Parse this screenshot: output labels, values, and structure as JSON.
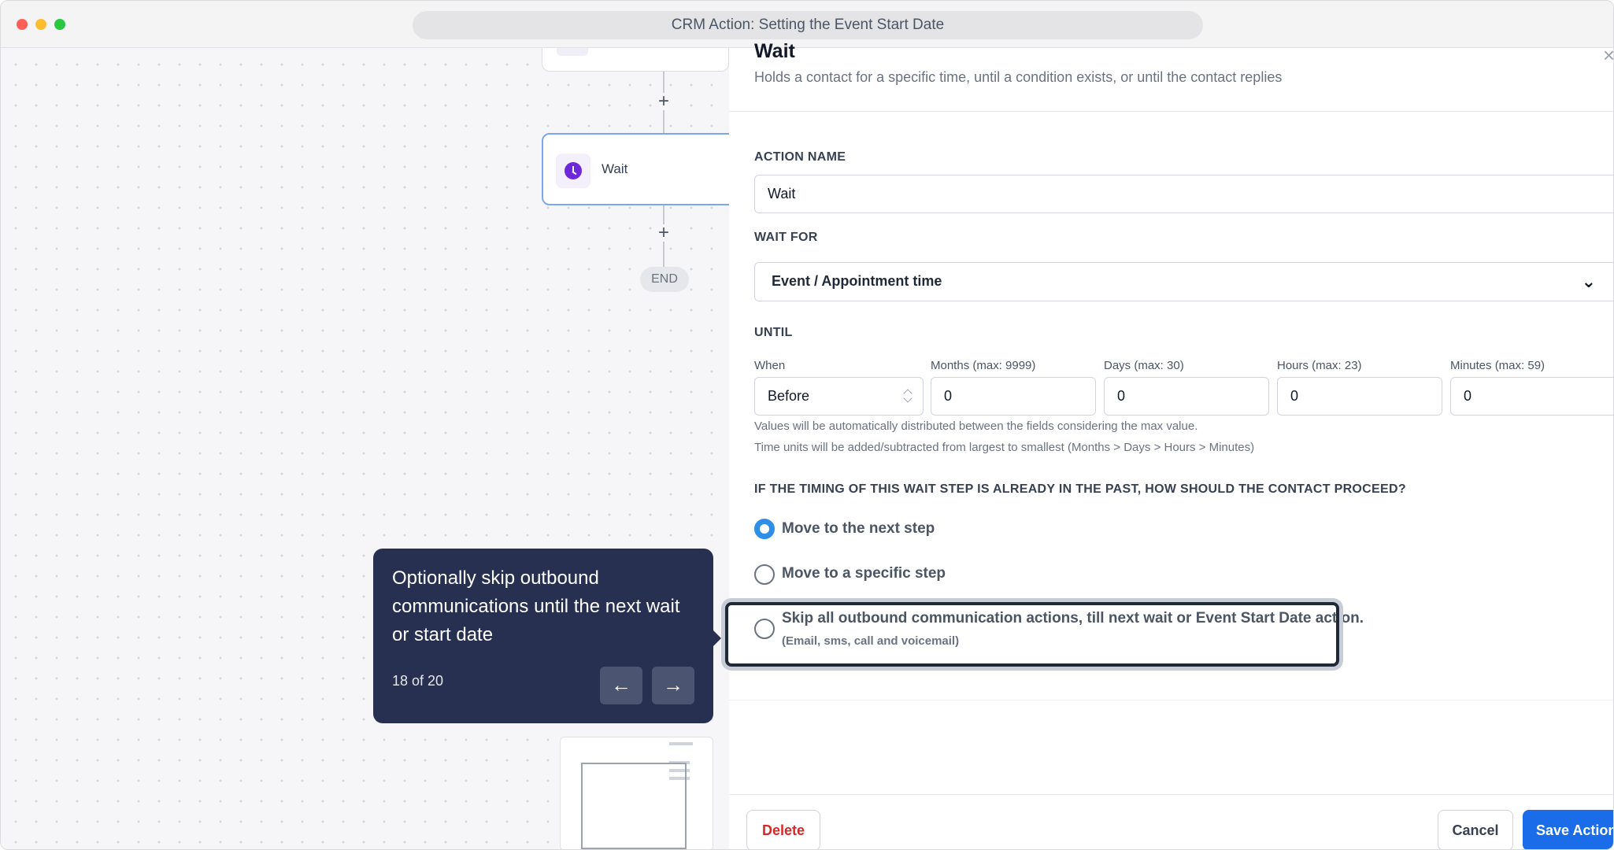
{
  "window": {
    "title": "CRM Action: Setting the Event Start Date"
  },
  "canvas": {
    "wait_node_label": "Wait",
    "plus_symbol": "+",
    "end_label": "END"
  },
  "tooltip": {
    "text": "Optionally skip outbound communications until the next wait or start date",
    "step": "18 of 20",
    "prev_symbol": "←",
    "next_symbol": "→"
  },
  "panel": {
    "title": "Wait",
    "subtitle": "Holds a contact for a specific time, until a condition exists, or until the contact replies",
    "close_symbol": "×",
    "action_name": {
      "label": "ACTION NAME",
      "value": "Wait"
    },
    "wait_for": {
      "label": "WAIT FOR",
      "value": "Event / Appointment time",
      "chevron": "⌄"
    },
    "until": {
      "label": "UNTIL",
      "when_label": "When",
      "when_value": "Before",
      "months_label": "Months (max: 9999)",
      "months_value": "0",
      "days_label": "Days (max: 30)",
      "days_value": "0",
      "hours_label": "Hours (max: 23)",
      "hours_value": "0",
      "minutes_label": "Minutes (max: 59)",
      "minutes_value": "0",
      "hint1": "Values will be automatically distributed between the fields considering the max value.",
      "hint2": "Time units will be added/subtracted from largest to smallest (Months > Days > Hours > Minutes)"
    },
    "past": {
      "question": "IF THE TIMING OF THIS WAIT STEP IS ALREADY IN THE PAST, HOW SHOULD THE CONTACT PROCEED?",
      "option1": "Move to the next step",
      "option2": "Move to a specific step",
      "option3": "Skip all outbound communication actions, till next wait or Event Start Date action.",
      "option3_sub": "(Email, sms, call and voicemail)",
      "selected": "option1"
    },
    "footer": {
      "delete": "Delete",
      "cancel": "Cancel",
      "save": "Save Action"
    }
  },
  "colors": {
    "accent": "#1a6ce8",
    "tooltip_bg": "#273050",
    "danger": "#dc2626",
    "radio_on": "#2f8fe8"
  }
}
